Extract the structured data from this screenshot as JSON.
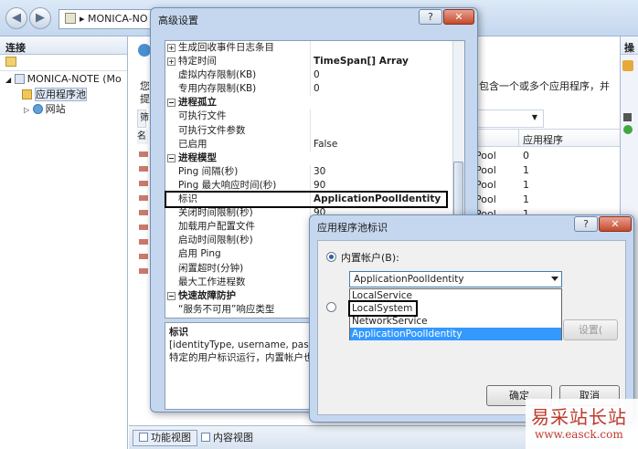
{
  "address": {
    "path": "MONICA-NO"
  },
  "sidebar": {
    "title": "连接",
    "tree": [
      {
        "label": "MONICA-NOTE (Mo"
      },
      {
        "label": "应用程序池"
      },
      {
        "label": "网站"
      }
    ]
  },
  "main": {
    "desc_line1": "您",
    "desc_line2": "提",
    "desc_right": "包含一个或多个应用程序，并",
    "col_header_app": "应用程序",
    "col_header_short": "名",
    "rows": [
      {
        "name": "Pool",
        "count": "0"
      },
      {
        "name": "Pool",
        "count": "1"
      },
      {
        "name": "Pool",
        "count": "1"
      },
      {
        "name": "Pool",
        "count": "1"
      },
      {
        "name": "Pool",
        "count": "1"
      }
    ],
    "filter_label": "筛"
  },
  "rightpane": {
    "title": "操"
  },
  "bottom": {
    "feature_view": "功能视图",
    "content_view": "内容视图"
  },
  "adv_dialog": {
    "title": "高级设置",
    "help": "?",
    "close": "✕",
    "rows": [
      {
        "k": "生成回收事件日志条目",
        "v": "",
        "type": "exp"
      },
      {
        "k": "特定时间",
        "v": "TimeSpan[] Array",
        "type": "exp-bold"
      },
      {
        "k": "虚拟内存限制(KB)",
        "v": "0"
      },
      {
        "k": "专用内存限制(KB)",
        "v": "0"
      },
      {
        "k": "进程孤立",
        "v": "",
        "type": "cat"
      },
      {
        "k": "可执行文件",
        "v": ""
      },
      {
        "k": "可执行文件参数",
        "v": ""
      },
      {
        "k": "已启用",
        "v": "False"
      },
      {
        "k": "进程模型",
        "v": "",
        "type": "cat"
      },
      {
        "k": "Ping 间隔(秒)",
        "v": "30"
      },
      {
        "k": "Ping 最大响应时间(秒)",
        "v": "90"
      },
      {
        "k": "标识",
        "v": "ApplicationPoolIdentity",
        "type": "bold"
      },
      {
        "k": "关闭时间限制(秒)",
        "v": "90"
      },
      {
        "k": "加载用户配置文件",
        "v": ""
      },
      {
        "k": "启动时间限制(秒)",
        "v": ""
      },
      {
        "k": "启用 Ping",
        "v": ""
      },
      {
        "k": "闲置超时(分钟)",
        "v": ""
      },
      {
        "k": "最大工作进程数",
        "v": ""
      },
      {
        "k": "快速故障防护",
        "v": "",
        "type": "cat"
      },
      {
        "k": "“服务不可用”响应类型",
        "v": ""
      }
    ],
    "desc_title": "标识",
    "desc_line1": "[identityType, username, passwo",
    "desc_line2": "特定的用户标识运行，内置帐户也就"
  },
  "identity_dialog": {
    "title": "应用程序池标识",
    "help": "?",
    "close": "✕",
    "builtin_label": "内置帐户(B):",
    "combo_value": "ApplicationPoolIdentity",
    "options": [
      "LocalService",
      "LocalSystem",
      "NetworkService",
      "ApplicationPoolIdentity"
    ],
    "set_button": "设置(",
    "ok_button": "确定",
    "cancel_button": "取消"
  },
  "watermark": {
    "line1": "易采站长站",
    "line2": "www.easck.com"
  },
  "colors": {
    "selection": "#3399ff",
    "title_bar": "#c5d7ee"
  }
}
